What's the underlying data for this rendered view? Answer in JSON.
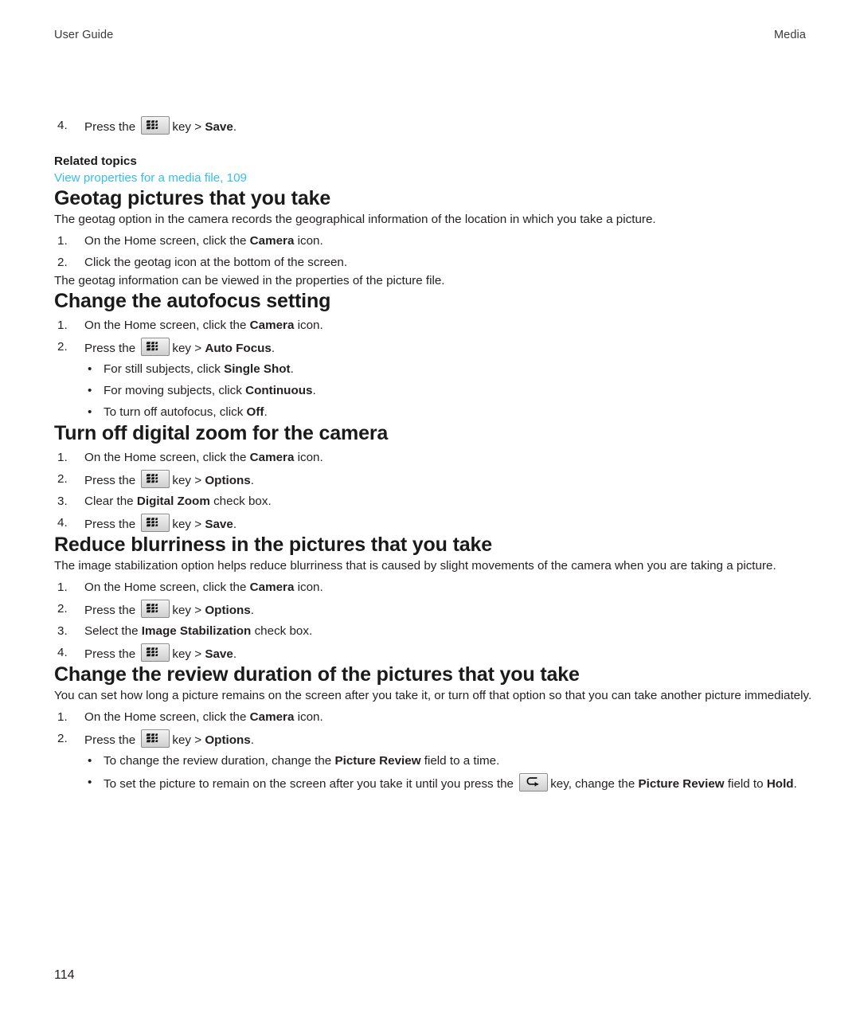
{
  "header": {
    "left": "User Guide",
    "right": "Media"
  },
  "footer": {
    "page_number": "114"
  },
  "colors": {
    "link": "#38bdea",
    "text": "#231f20",
    "key_border": "#8a8a8a"
  },
  "icons": {
    "menu_key": "blackberry-menu-key-icon",
    "escape_key": "escape-back-key-icon"
  },
  "top_step": {
    "number": "4.",
    "text_before": "Press the",
    "text_middle": "key >",
    "bold": "Save",
    "text_after": "."
  },
  "related": {
    "title": "Related topics",
    "link": "View properties for a media file, 109"
  },
  "sections": [
    {
      "heading": "Geotag pictures that you take",
      "intro": "The geotag option in the camera records the geographical information of the location in which you take a picture.",
      "steps": [
        {
          "number": "1.",
          "pre": "On the Home screen, click the",
          "bold": "Camera",
          "post": "icon."
        },
        {
          "number": "2.",
          "pre": "Click the geotag icon at the bottom of the screen.",
          "bold": "",
          "post": ""
        }
      ],
      "outro": "The geotag information can be viewed in the properties of the picture file."
    },
    {
      "heading": "Change the autofocus setting",
      "steps": [
        {
          "number": "1.",
          "pre": "On the Home screen, click the",
          "bold": "Camera",
          "post": "icon."
        },
        {
          "number": "2.",
          "pre": "Press the",
          "key": "menu",
          "mid": "key >",
          "bold": "Auto Focus",
          "post": "."
        }
      ],
      "bullets": [
        {
          "pre": "For still subjects, click",
          "bold": "Single Shot",
          "post": "."
        },
        {
          "pre": "For moving subjects, click",
          "bold": "Continuous",
          "post": "."
        },
        {
          "pre": "To turn off autofocus, click",
          "bold": "Off",
          "post": "."
        }
      ]
    },
    {
      "heading": "Turn off digital zoom for the camera",
      "steps": [
        {
          "number": "1.",
          "pre": "On the Home screen, click the",
          "bold": "Camera",
          "post": "icon."
        },
        {
          "number": "2.",
          "pre": "Press the",
          "key": "menu",
          "mid": "key >",
          "bold": "Options",
          "post": "."
        },
        {
          "number": "3.",
          "pre": "Clear the",
          "bold": "Digital Zoom",
          "post": "check box."
        },
        {
          "number": "4.",
          "pre": "Press the",
          "key": "menu",
          "mid": "key >",
          "bold": "Save",
          "post": "."
        }
      ]
    },
    {
      "heading": "Reduce blurriness in the pictures that you take",
      "intro": "The image stabilization option helps reduce blurriness that is caused by slight movements of the camera when you are taking a picture.",
      "steps": [
        {
          "number": "1.",
          "pre": "On the Home screen, click the",
          "bold": "Camera",
          "post": "icon."
        },
        {
          "number": "2.",
          "pre": "Press the",
          "key": "menu",
          "mid": "key >",
          "bold": "Options",
          "post": "."
        },
        {
          "number": "3.",
          "pre": "Select the",
          "bold": "Image Stabilization",
          "post": "check box."
        },
        {
          "number": "4.",
          "pre": "Press the",
          "key": "menu",
          "mid": "key >",
          "bold": "Save",
          "post": "."
        }
      ]
    },
    {
      "heading": "Change the review duration of the pictures that you take",
      "intro": "You can set how long a picture remains on the screen after you take it, or turn off that option so that you can take another picture immediately.",
      "steps": [
        {
          "number": "1.",
          "pre": "On the Home screen, click the",
          "bold": "Camera",
          "post": "icon."
        },
        {
          "number": "2.",
          "pre": "Press the",
          "key": "menu",
          "mid": "key >",
          "bold": "Options",
          "post": "."
        }
      ],
      "bullets": [
        {
          "pre": "To change the review duration, change the",
          "bold": "Picture Review",
          "post": "field to a time."
        },
        {
          "pre": "To set the picture to remain on the screen after you take it until you press the",
          "key": "escape",
          "mid": "key, change the",
          "bold": "Picture Review",
          "post": "field to",
          "bold2": "Hold",
          "post2": "."
        }
      ]
    }
  ]
}
